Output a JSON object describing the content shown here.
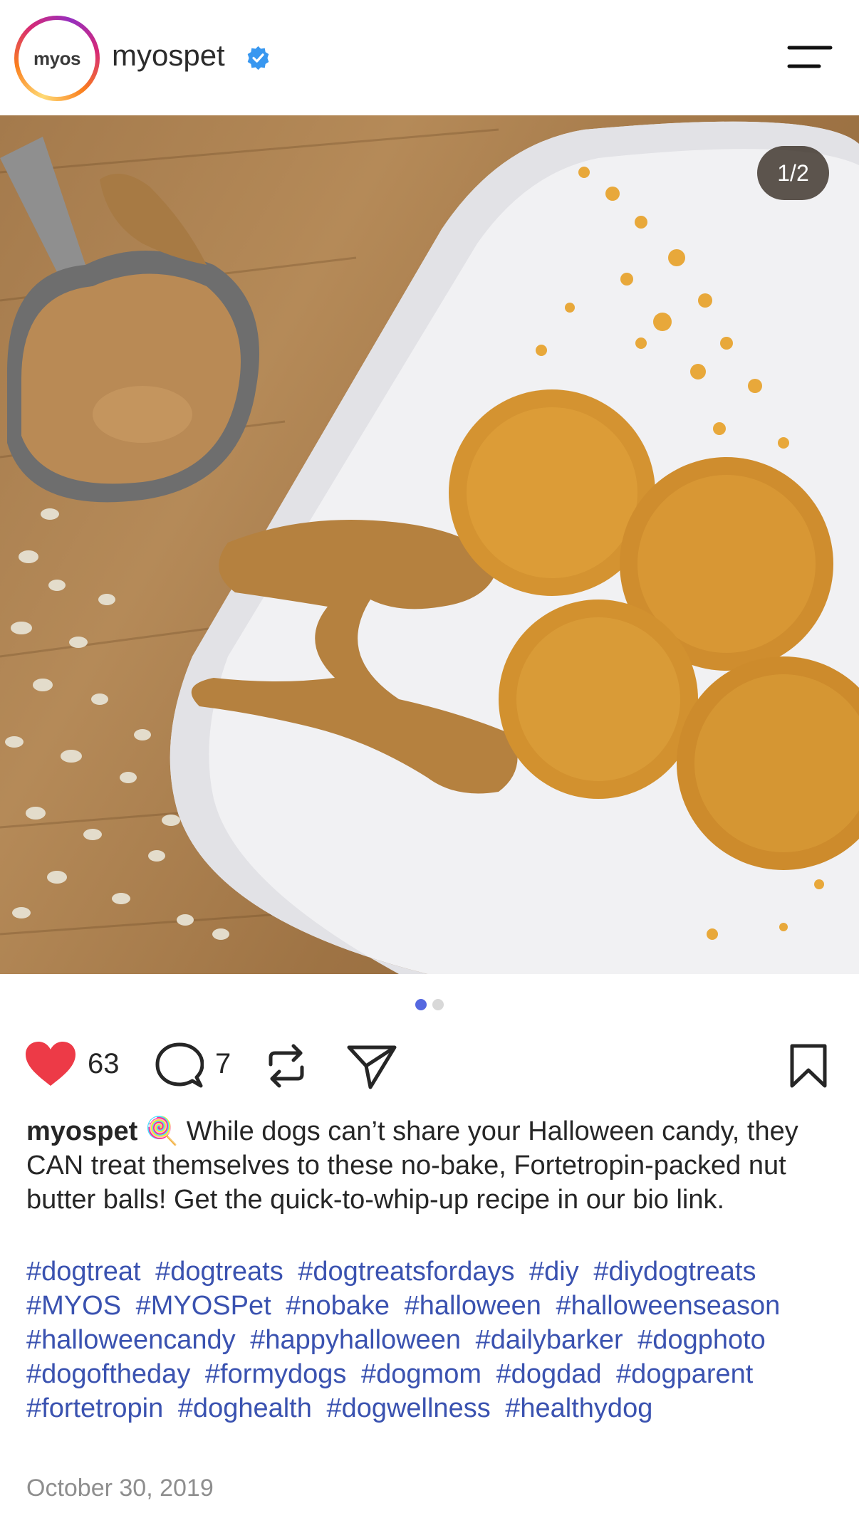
{
  "header": {
    "avatar_text": "myos",
    "username": "myospet",
    "verified_icon": "verified-check-icon",
    "menu_icon": "hamburger-menu-icon"
  },
  "post": {
    "image_counter": "1/2",
    "carousel_dots": 2,
    "active_dot": 1
  },
  "actions": {
    "like_icon": "heart-filled-icon",
    "like_count": "63",
    "comment_icon": "comment-bubble-icon",
    "comment_count": "7",
    "repost_icon": "repost-icon",
    "share_icon": "share-paper-plane-icon",
    "save_icon": "bookmark-icon",
    "like_color": "#ed3a47"
  },
  "caption": {
    "username": "myospet",
    "emoji": "🍭",
    "text": "While dogs can’t share your Halloween candy, they CAN treat themselves to these no-bake, Fortetropin-packed nut butter balls! Get the quick-to-whip-up recipe in our bio link."
  },
  "hashtags": [
    "#dogtreat",
    "#dogtreats",
    "#dogtreatsfordays",
    "#diy",
    "#diydogtreats",
    "#MYOS",
    "#MYOSPet",
    "#nobake",
    "#halloween",
    "#halloweenseason",
    "#halloweencandy",
    "#happyhalloween",
    "#dailybarker",
    "#dogphoto",
    "#dogoftheday",
    "#formydogs",
    "#dogmom",
    "#dogdad",
    "#dogparent",
    "#fortetropin",
    "#doghealth",
    "#dogwellness",
    "#healthydog"
  ],
  "date": "October 30, 2019",
  "colors": {
    "hashtag": "#3a52b0",
    "dot_active": "#5568e0",
    "verified": "#3897f0"
  }
}
